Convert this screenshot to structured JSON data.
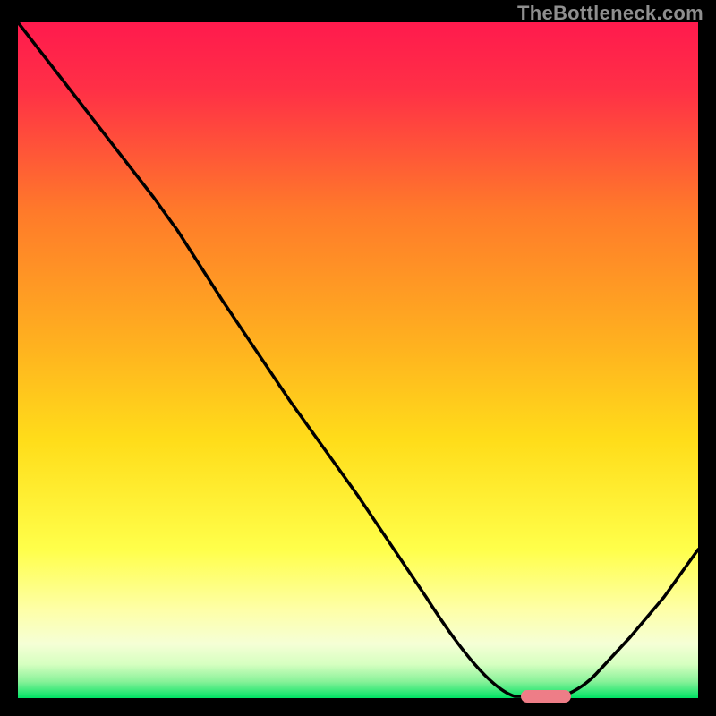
{
  "watermark": "TheBottleneck.com",
  "chart_data": {
    "type": "line",
    "title": "",
    "xlabel": "",
    "ylabel": "",
    "x": [
      0.0,
      0.1,
      0.2,
      0.23,
      0.3,
      0.4,
      0.5,
      0.6,
      0.7,
      0.75,
      0.8,
      0.85,
      0.9,
      0.95,
      1.0
    ],
    "y": [
      1.0,
      0.87,
      0.74,
      0.7,
      0.59,
      0.44,
      0.3,
      0.15,
      0.02,
      0.0,
      0.0,
      0.03,
      0.09,
      0.15,
      0.22
    ],
    "xlim": [
      0,
      1
    ],
    "ylim": [
      0,
      1
    ],
    "background_gradient": [
      "#ff1a4d",
      "#ff7a2a",
      "#ffcf1f",
      "#ffff66",
      "#f8ffca",
      "#00e264"
    ],
    "minimum_marker": {
      "x_center": 0.775,
      "width": 0.07,
      "y": 0.0,
      "color": "#ee7d87"
    },
    "annotations": []
  }
}
